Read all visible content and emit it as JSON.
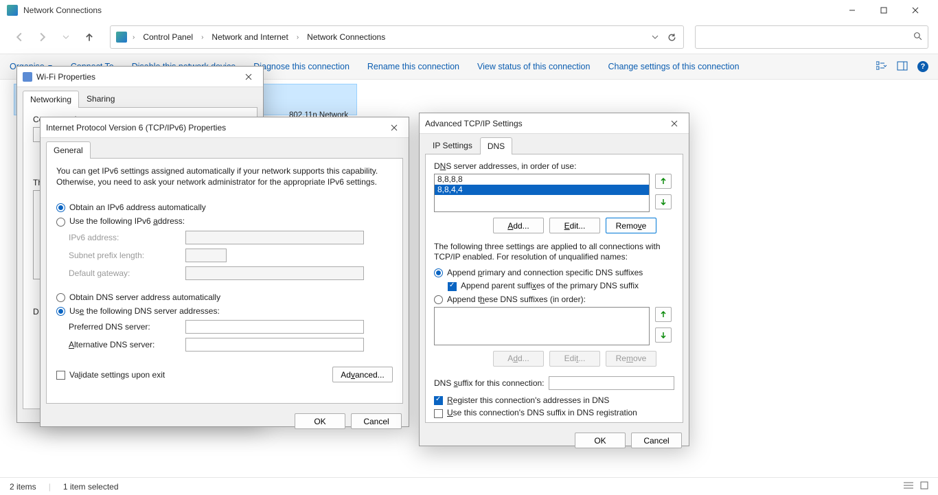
{
  "window": {
    "title": "Network Connections"
  },
  "breadcrumb": {
    "items": [
      "Control Panel",
      "Network and Internet",
      "Network Connections"
    ]
  },
  "toolbar": {
    "organise": "Organise",
    "items": [
      "Connect To",
      "Disable this network device",
      "Diagnose this connection",
      "Rename this connection",
      "View status of this connection",
      "Change settings of this connection"
    ]
  },
  "adapter": {
    "sub": "802.11n Network Adap..."
  },
  "statusbar": {
    "items_count": "2 items",
    "selected": "1 item selected"
  },
  "wifi_dialog": {
    "title": "Wi-Fi Properties",
    "tabs": {
      "networking": "Networking",
      "sharing": "Sharing"
    },
    "connect_using": "Connect using:",
    "this_connection": "Th",
    "d_label": "D"
  },
  "ipv6_dialog": {
    "title": "Internet Protocol Version 6 (TCP/IPv6) Properties",
    "tab_general": "General",
    "intro": "You can get IPv6 settings assigned automatically if your network supports this capability. Otherwise, you need to ask your network administrator for the appropriate IPv6 settings.",
    "r_ip_auto": "Obtain an IPv6 address automatically",
    "r_ip_manual_pre": "Use the following IPv6 ",
    "r_ip_manual_u": "a",
    "r_ip_manual_post": "ddress:",
    "lbl_ip": "IPv6 address:",
    "lbl_prefix": "Subnet prefix length:",
    "lbl_gw": "Default gateway:",
    "r_dns_auto": "Obtain DNS server address automatically",
    "r_dns_manual_pre": "Us",
    "r_dns_manual_u": "e",
    "r_dns_manual_post": " the following DNS server addresses:",
    "lbl_pref": "Preferred DNS server:",
    "lbl_alt_pre": "",
    "lbl_alt_u": "A",
    "lbl_alt_post": "lternative DNS server:",
    "chk_validate_pre": "Va",
    "chk_validate_u": "l",
    "chk_validate_post": "idate settings upon exit",
    "btn_advanced_pre": "Ad",
    "btn_advanced_u": "v",
    "btn_advanced_post": "anced...",
    "btn_ok": "OK",
    "btn_cancel": "Cancel"
  },
  "adv_dialog": {
    "title": "Advanced TCP/IP Settings",
    "tab_ip": "IP Settings",
    "tab_dns": "DNS",
    "lbl_servers_pre": "D",
    "lbl_servers_u": "N",
    "lbl_servers_post": "S server addresses, in order of use:",
    "servers": [
      "8,8,8,8",
      "8,8,4,4"
    ],
    "btn_add_pre": "",
    "btn_add_u": "A",
    "btn_add_post": "dd...",
    "btn_edit_pre": "",
    "btn_edit_u": "E",
    "btn_edit_post": "dit...",
    "btn_remove_pre": "Remo",
    "btn_remove_u": "v",
    "btn_remove_post": "e",
    "note": "The following three settings are applied to all connections with TCP/IP enabled. For resolution of unqualified names:",
    "r_append_primary_pre": "Append ",
    "r_append_primary_u": "p",
    "r_append_primary_post": "rimary and connection specific DNS suffixes",
    "chk_parent_pre": "Append parent suffi",
    "chk_parent_u": "x",
    "chk_parent_post": "es of the primary DNS suffix",
    "r_append_these_pre": "Append t",
    "r_append_these_u": "h",
    "r_append_these_post": "ese DNS suffixes (in order):",
    "btn_add2_pre": "A",
    "btn_add2_u": "d",
    "btn_add2_post": "d...",
    "btn_edit2_pre": "Edi",
    "btn_edit2_u": "t",
    "btn_edit2_post": "...",
    "btn_remove2_pre": "Re",
    "btn_remove2_u": "m",
    "btn_remove2_post": "ove",
    "lbl_suffix_pre": "DNS ",
    "lbl_suffix_u": "s",
    "lbl_suffix_post": "uffix for this connection:",
    "chk_register_pre": "",
    "chk_register_u": "R",
    "chk_register_post": "egister this connection's addresses in DNS",
    "chk_usesuffix_pre": "",
    "chk_usesuffix_u": "U",
    "chk_usesuffix_post": "se this connection's DNS suffix in DNS registration",
    "btn_ok": "OK",
    "btn_cancel": "Cancel"
  }
}
